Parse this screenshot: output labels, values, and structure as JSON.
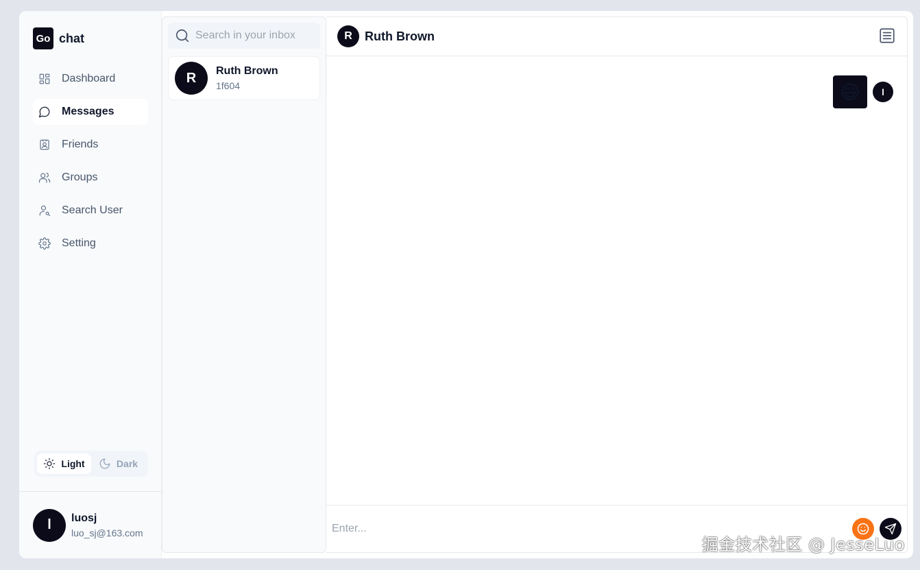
{
  "brand": {
    "logo_text": "Go",
    "name": "chat"
  },
  "nav": {
    "items": [
      {
        "label": "Dashboard",
        "icon": "dashboard-icon",
        "active": false
      },
      {
        "label": "Messages",
        "icon": "message-icon",
        "active": true
      },
      {
        "label": "Friends",
        "icon": "contact-card-icon",
        "active": false
      },
      {
        "label": "Groups",
        "icon": "users-icon",
        "active": false
      },
      {
        "label": "Search User",
        "icon": "user-search-icon",
        "active": false
      },
      {
        "label": "Setting",
        "icon": "gear-icon",
        "active": false
      }
    ]
  },
  "theme": {
    "light_label": "Light",
    "dark_label": "Dark",
    "selected": "Light"
  },
  "current_user": {
    "initial": "l",
    "name": "luosj",
    "email": "luo_sj@163.com"
  },
  "search": {
    "placeholder": "Search in your inbox",
    "value": ""
  },
  "conversations": [
    {
      "initial": "R",
      "name": "Ruth Brown",
      "preview": "1f604"
    }
  ],
  "chat": {
    "title": "Ruth Brown",
    "initial": "R",
    "messages": [
      {
        "content": "😄",
        "sender_initial": "l",
        "outgoing": true
      }
    ],
    "composer_placeholder": "Enter..."
  },
  "colors": {
    "accent_dark": "#0b0b1a",
    "emoji_button": "#f97316"
  },
  "watermark": "掘金技术社区 @ JesseLuo"
}
